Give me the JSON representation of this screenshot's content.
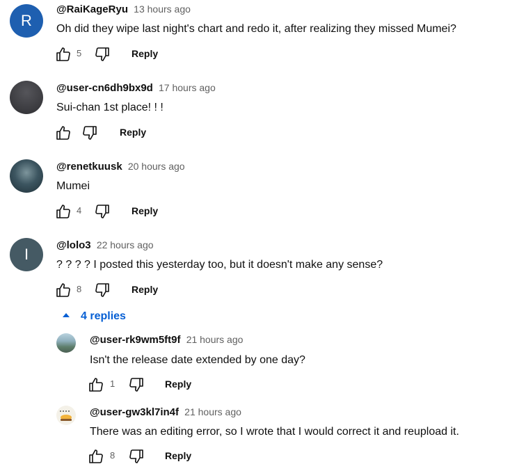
{
  "comments": [
    {
      "handle": "@RaiKageRyu",
      "time": "13 hours ago",
      "text": "Oh did they wipe last night's chart and redo it, after realizing they missed Mumei?",
      "likes": "5",
      "reply_label": "Reply",
      "avatar_letter": "R",
      "avatar_color": "#1e5fb0"
    },
    {
      "handle": "@user-cn6dh9bx9d",
      "time": "17 hours ago",
      "text": "Sui-chan 1st place! ! !",
      "likes": "",
      "reply_label": "Reply",
      "avatar_color": "#3b3b3f"
    },
    {
      "handle": "@renetkuusk",
      "time": "20 hours ago",
      "text": "Mumei",
      "likes": "4",
      "reply_label": "Reply",
      "avatar_color": "#2f4650"
    },
    {
      "handle": "@lolo3",
      "time": "22 hours ago",
      "text": "? ? ? ? I posted this yesterday too, but it doesn't make any sense?",
      "likes": "8",
      "reply_label": "Reply",
      "avatar_letter": "I",
      "avatar_color": "#455a64"
    }
  ],
  "replies_toggle": {
    "label": "4 replies"
  },
  "replies": [
    {
      "handle": "@user-rk9wm5ft9f",
      "time": "21 hours ago",
      "text": "Isn't the release date extended by one day?",
      "likes": "1",
      "reply_label": "Reply",
      "avatar_color": "#6f8f9c"
    },
    {
      "handle": "@user-gw3kl7in4f",
      "time": "21 hours ago",
      "text": "There was an editing error, so I wrote that I would correct it and reupload it.",
      "likes": "8",
      "reply_label": "Reply",
      "avatar_color": "#f4f1e8"
    }
  ]
}
